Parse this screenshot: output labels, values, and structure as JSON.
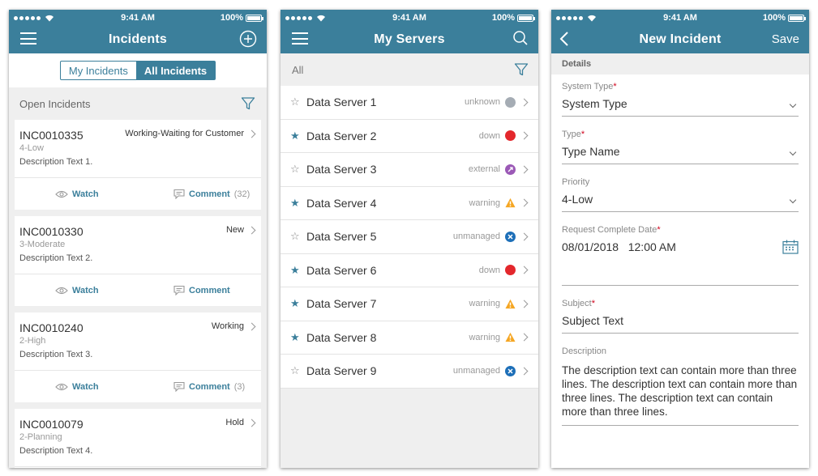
{
  "status": {
    "time": "9:41 AM",
    "battery": "100%"
  },
  "incidents": {
    "title": "Incidents",
    "tabs": [
      "My Incidents",
      "All Incidents"
    ],
    "active_tab": 1,
    "section": "Open Incidents",
    "watch_label": "Watch",
    "comment_label": "Comment",
    "cards": [
      {
        "number": "INC0010335",
        "priority": "4-Low",
        "description": "Description Text 1.",
        "state": "Working-Waiting for Customer",
        "comment_count": "(32)"
      },
      {
        "number": "INC0010330",
        "priority": "3-Moderate",
        "description": "Description Text 2.",
        "state": "New",
        "comment_count": ""
      },
      {
        "number": "INC0010240",
        "priority": "2-High",
        "description": "Description Text 3.",
        "state": "Working",
        "comment_count": "(3)"
      },
      {
        "number": "INC0010079",
        "priority": "2-Planning",
        "description": "Description Text 4.",
        "state": "Hold",
        "comment_count": ""
      }
    ]
  },
  "servers": {
    "title": "My Servers",
    "filter": "All",
    "items": [
      {
        "name": "Data Server 1",
        "starred": false,
        "status": "unknown",
        "icon": "unknown-icon",
        "color": "#a5acb4"
      },
      {
        "name": "Data Server 2",
        "starred": true,
        "status": "down",
        "icon": "down-icon",
        "color": "#e3272c"
      },
      {
        "name": "Data Server 3",
        "starred": false,
        "status": "external",
        "icon": "external-icon",
        "color": "#9b59b6"
      },
      {
        "name": "Data Server 4",
        "starred": true,
        "status": "warning",
        "icon": "warning-icon",
        "color": "#f5a623"
      },
      {
        "name": "Data Server 5",
        "starred": false,
        "status": "unmanaged",
        "icon": "unmanaged-icon",
        "color": "#1d6fb8"
      },
      {
        "name": "Data Server 6",
        "starred": true,
        "status": "down",
        "icon": "down-icon",
        "color": "#e3272c"
      },
      {
        "name": "Data Server 7",
        "starred": true,
        "status": "warning",
        "icon": "warning-icon",
        "color": "#f5a623"
      },
      {
        "name": "Data Server 8",
        "starred": true,
        "status": "warning",
        "icon": "warning-icon",
        "color": "#f5a623"
      },
      {
        "name": "Data Server 9",
        "starred": false,
        "status": "unmanaged",
        "icon": "unmanaged-icon",
        "color": "#1d6fb8"
      }
    ]
  },
  "new_incident": {
    "title": "New Incident",
    "save": "Save",
    "section": "Details",
    "system_type": {
      "label": "System Type",
      "value": "System Type"
    },
    "type": {
      "label": "Type",
      "value": "Type Name"
    },
    "priority": {
      "label": "Priority",
      "value": "4-Low"
    },
    "request_date": {
      "label": "Request Complete Date",
      "value": "08/01/2018   12:00 AM"
    },
    "subject": {
      "label": "Subject",
      "value": "Subject Text"
    },
    "description": {
      "label": "Description",
      "value": "The description text can contain more than three lines. The description text can contain more than three lines. The description text can contain more than three lines."
    },
    "required_mark": "*"
  },
  "colors": {
    "brand": "#3b7f9b",
    "required": "#d0021b"
  }
}
